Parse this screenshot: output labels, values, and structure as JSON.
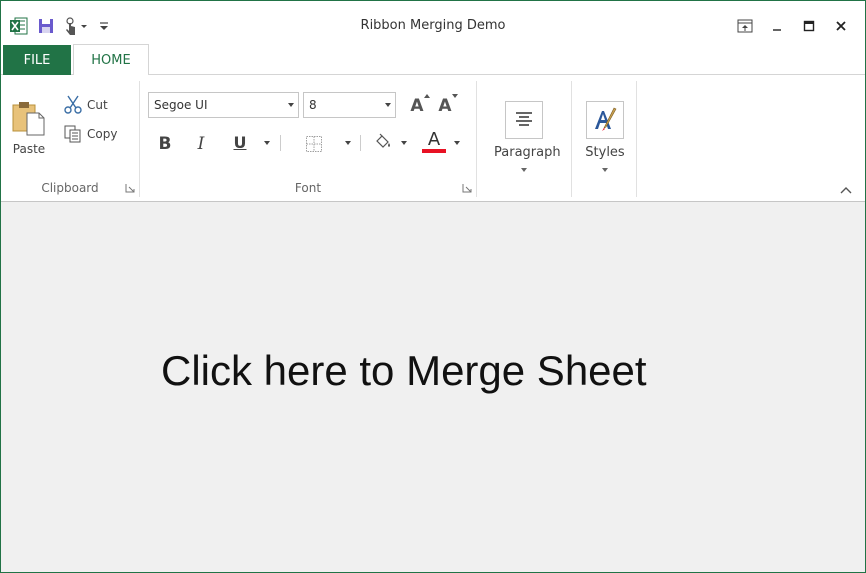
{
  "window": {
    "title": "Ribbon Merging Demo"
  },
  "qat": {
    "items": [
      "excel-logo-icon",
      "save-icon",
      "touch-mode-icon",
      "customize-qat-icon"
    ]
  },
  "window_controls": [
    "ribbon-display-options-icon",
    "minimize-icon",
    "maximize-icon",
    "close-icon"
  ],
  "tabs": {
    "file": "FILE",
    "home": "HOME"
  },
  "clipboard": {
    "group_label": "Clipboard",
    "paste": "Paste",
    "cut": "Cut",
    "copy": "Copy"
  },
  "font": {
    "group_label": "Font",
    "family": "Segoe UI",
    "size": "8",
    "bold": "B",
    "italic": "I",
    "underline": "U",
    "font_color_glyph": "A",
    "grow_glyph": "A",
    "shrink_glyph": "A"
  },
  "paragraph": {
    "label": "Paragraph"
  },
  "styles": {
    "label": "Styles"
  },
  "content": {
    "merge_text": "Click here to Merge Sheet"
  },
  "colors": {
    "accent": "#217346",
    "font_color_bar": "#e81123",
    "content_bg": "#f0f0f0"
  }
}
